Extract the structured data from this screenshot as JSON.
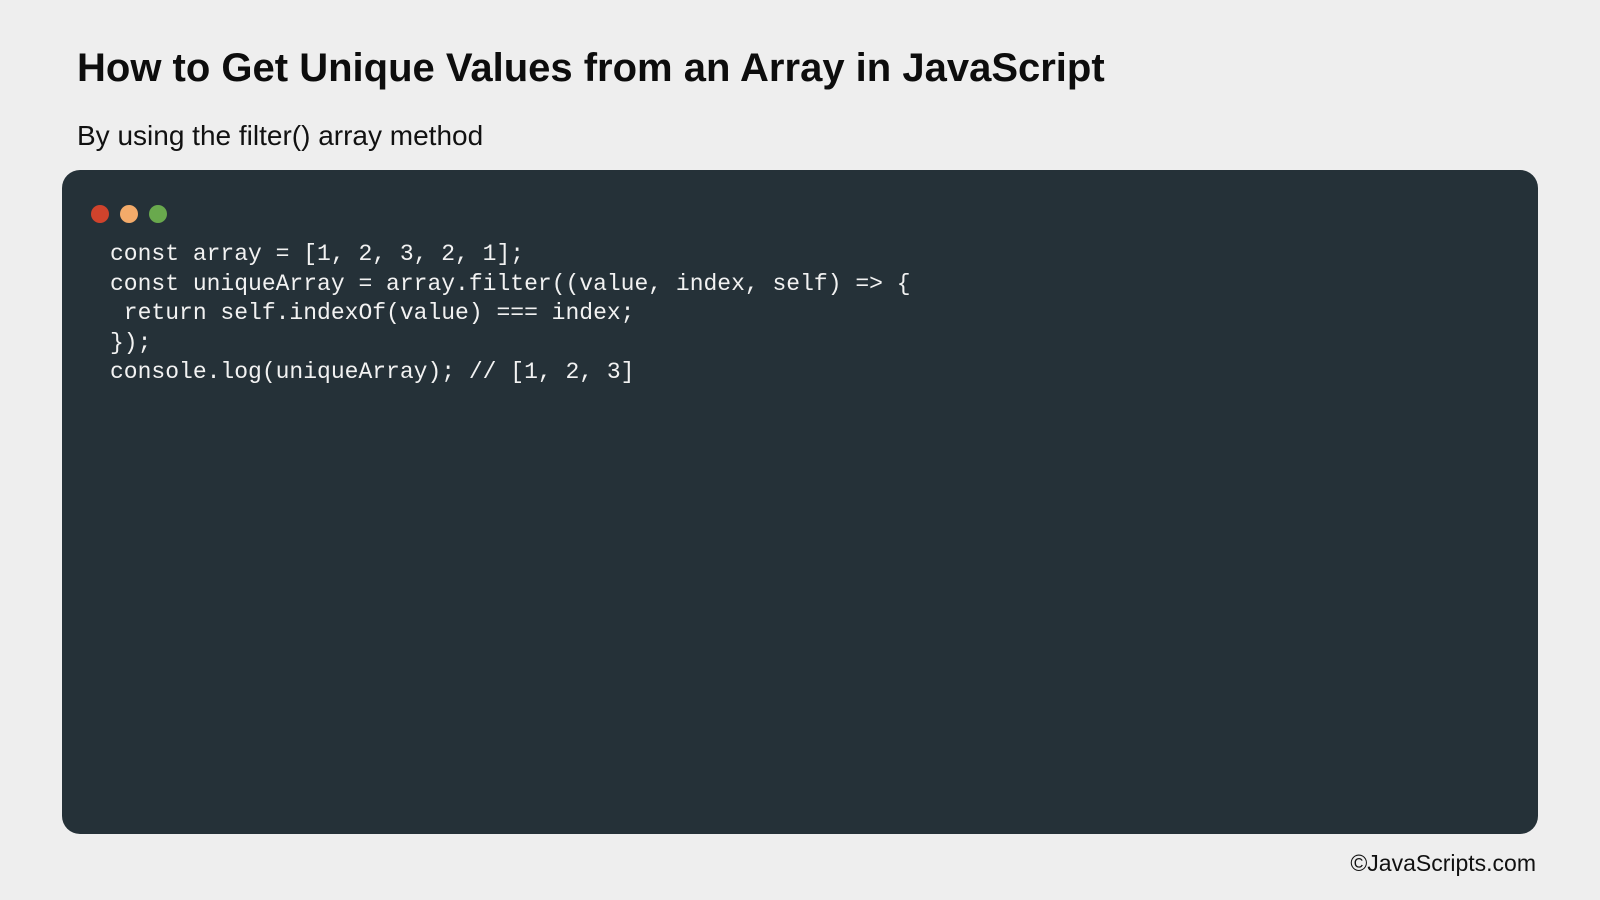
{
  "page": {
    "title": "How to Get Unique Values from an Array in JavaScript",
    "subtitle": "By using the filter() array method",
    "copyright": "©JavaScripts.com"
  },
  "code_window": {
    "dots": [
      {
        "name": "close-dot",
        "color": "#d0432c"
      },
      {
        "name": "minimize-dot",
        "color": "#f4ab6a"
      },
      {
        "name": "maximize-dot",
        "color": "#69a94d"
      }
    ],
    "lines": [
      "const array = [1, 2, 3, 2, 1];",
      "const uniqueArray = array.filter((value, index, self) => {",
      " return self.indexOf(value) === index;",
      "});",
      "console.log(uniqueArray); // [1, 2, 3]"
    ]
  },
  "colors": {
    "background": "#eeeeee",
    "code_background": "#253138",
    "code_text": "#f2f2f2"
  }
}
